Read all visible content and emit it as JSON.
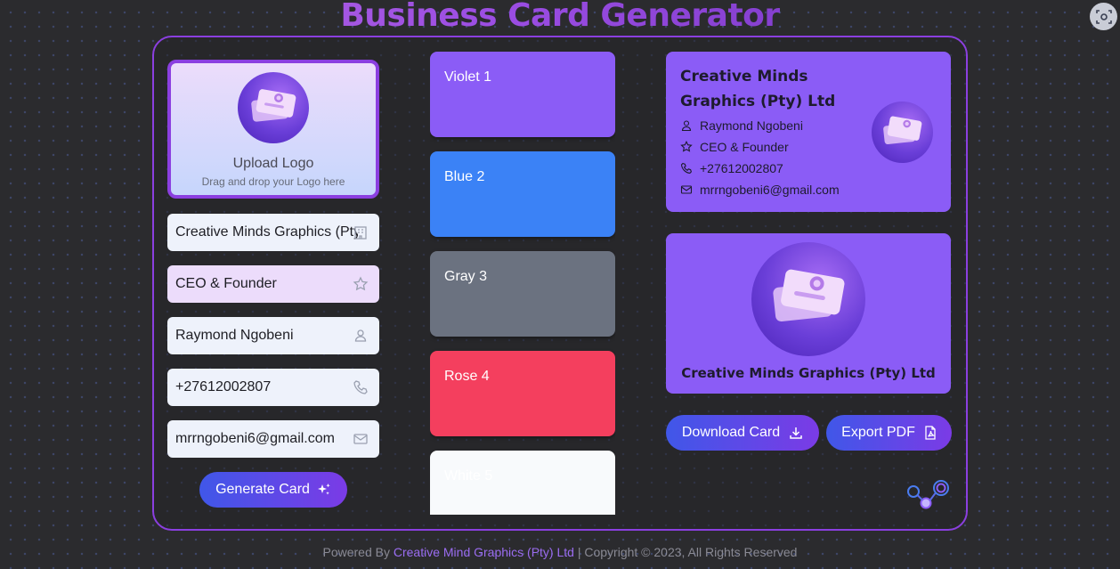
{
  "header": {
    "title": "Business Card Generator"
  },
  "top_right_icon": "screenshot-capture-icon",
  "upload": {
    "title": "Upload Logo",
    "subtitle": "Drag and drop your Logo here"
  },
  "fields": {
    "company": {
      "value": "Creative Minds Graphics (Pty) Ltd",
      "icon": "building-icon"
    },
    "title": {
      "value": "CEO & Founder",
      "icon": "star-icon"
    },
    "name": {
      "value": "Raymond Ngobeni",
      "icon": "user-icon"
    },
    "phone": {
      "value": "+27612002807",
      "icon": "phone-icon"
    },
    "email": {
      "value": "mrrngobeni6@gmail.com",
      "icon": "mail-icon"
    }
  },
  "generate_button": {
    "label": "Generate Card",
    "icon": "sparkles-icon"
  },
  "swatches": [
    {
      "label": "Violet 1",
      "color": "#8b5cf6"
    },
    {
      "label": "Blue 2",
      "color": "#3b82f6"
    },
    {
      "label": "Gray 3",
      "color": "#6b7280"
    },
    {
      "label": "Rose 4",
      "color": "#f43f5e"
    },
    {
      "label": "White 5",
      "color": "#f8fafc"
    }
  ],
  "card_preview": {
    "company": "Creative Minds Graphics (Pty) Ltd",
    "name": "Raymond Ngobeni",
    "title": "CEO & Founder",
    "phone": "+27612002807",
    "email": "mrrngobeni6@gmail.com",
    "background": "#8b5cf6"
  },
  "card_back": {
    "company": "Creative Minds Graphics (Pty) Ltd"
  },
  "actions": {
    "download_label": "Download Card",
    "export_label": "Export PDF"
  },
  "footer": {
    "prefix": "Powered By",
    "brand": "Creative Mind Graphics (Pty) Ltd",
    "suffix": "| Copyright © 2023, All Rights Reserved"
  }
}
